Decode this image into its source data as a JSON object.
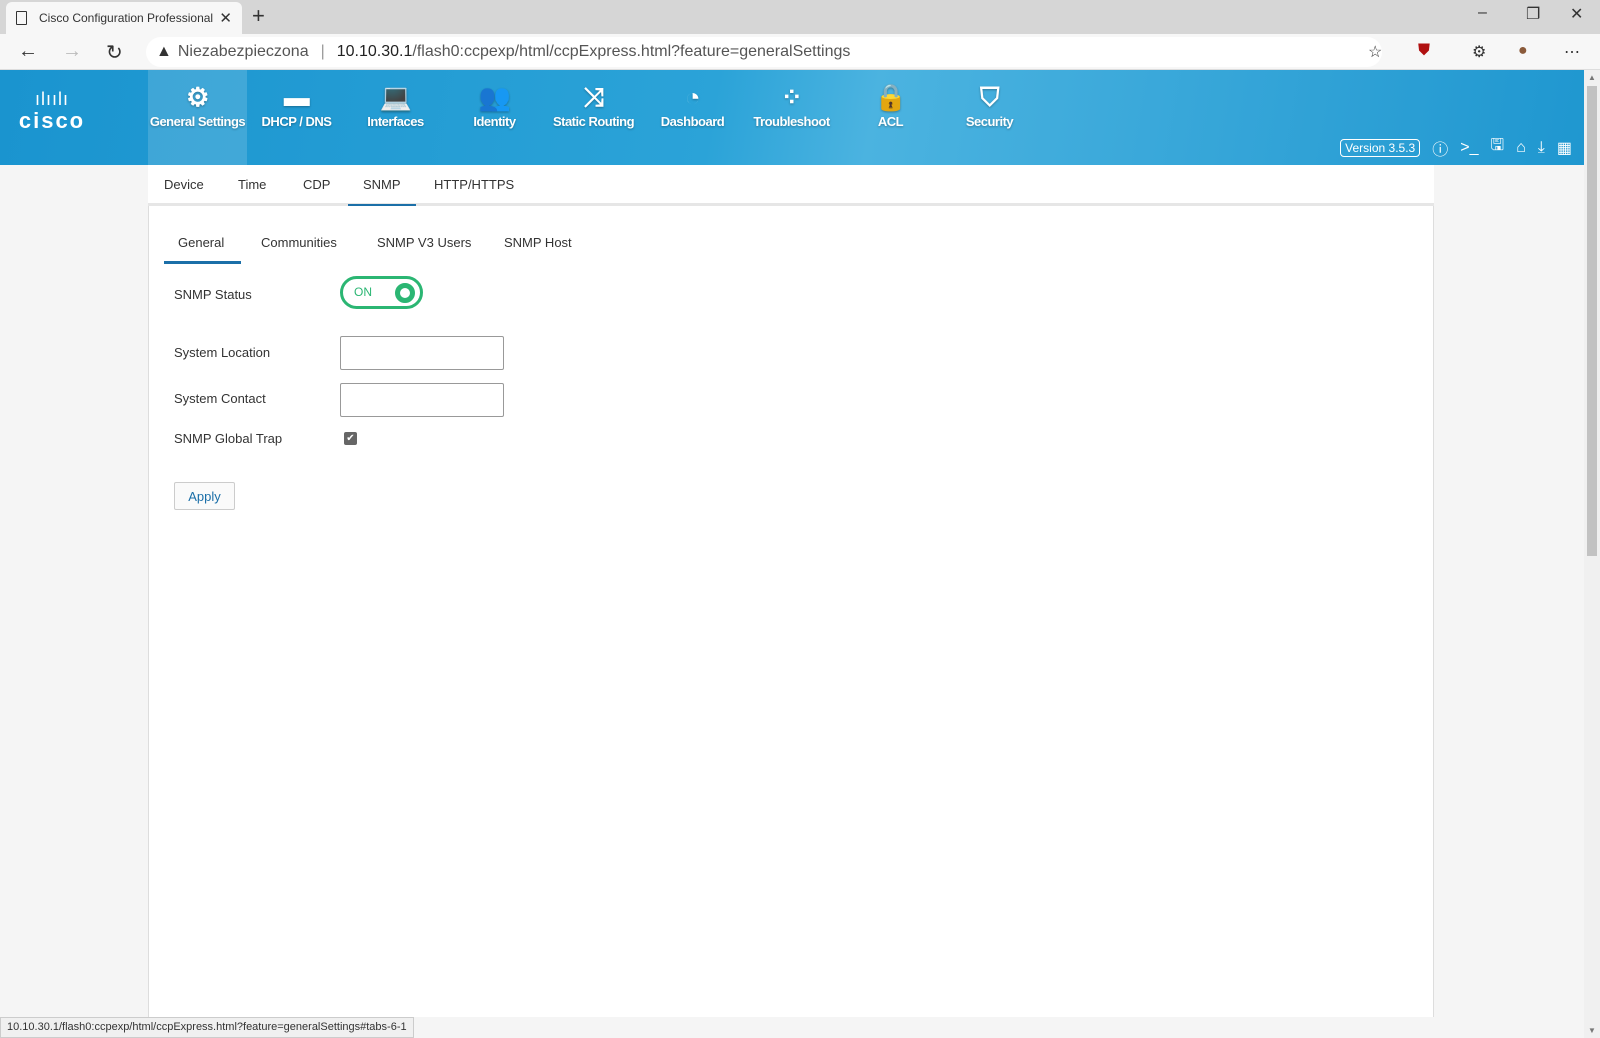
{
  "browser": {
    "tab_title": "Cisco Configuration Professional",
    "security_label": "Niezabezpieczona",
    "url_host": "10.10.30.1",
    "url_path": "/flash0:ccpexp/html/ccpExpress.html?feature=generalSettings",
    "status_url": "10.10.30.1/flash0:ccpexp/html/ccpExpress.html?feature=generalSettings#tabs-6-1"
  },
  "app": {
    "logo_text": "cisco",
    "version": "Version 3.5.3",
    "nav": [
      {
        "label": "General Settings",
        "icon": "⚙"
      },
      {
        "label": "DHCP / DNS",
        "icon": "▬"
      },
      {
        "label": "Interfaces",
        "icon": "💻"
      },
      {
        "label": "Identity",
        "icon": "👥"
      },
      {
        "label": "Static Routing",
        "icon": "⤨"
      },
      {
        "label": "Dashboard",
        "icon": "◔"
      },
      {
        "label": "Troubleshoot",
        "icon": "⁘"
      },
      {
        "label": "ACL",
        "icon": "🔒"
      },
      {
        "label": "Security",
        "icon": "⛉"
      }
    ],
    "subtabs": [
      "Device",
      "Time",
      "CDP",
      "SNMP",
      "HTTP/HTTPS"
    ],
    "inner_tabs": [
      "General",
      "Communities",
      "SNMP V3 Users",
      "SNMP Host"
    ]
  },
  "form": {
    "snmp_status_label": "SNMP Status",
    "snmp_status_value": "ON",
    "location_label": "System Location",
    "location_value": "",
    "contact_label": "System Contact",
    "contact_value": "",
    "trap_label": "SNMP Global Trap",
    "trap_checked": true,
    "apply_label": "Apply"
  }
}
